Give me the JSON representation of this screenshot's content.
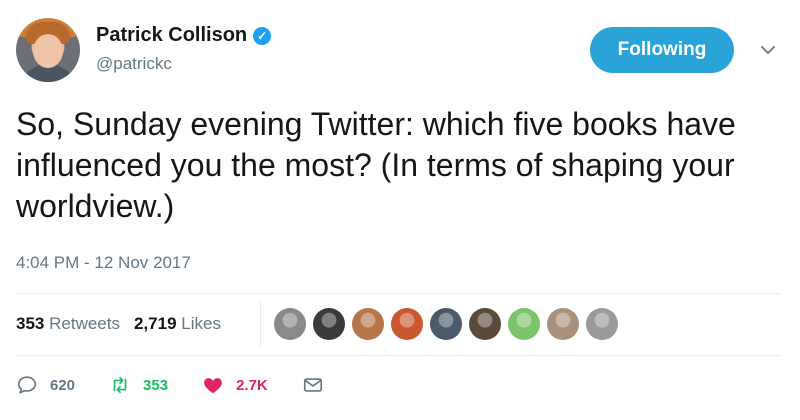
{
  "author": {
    "name": "Patrick Collison",
    "handle": "@patrickc",
    "verified_icon": "verified-badge-icon",
    "follow_label": "Following"
  },
  "tweet": {
    "text": "So, Sunday evening Twitter: which five books have influenced you the most? (In terms of shaping your worldview.)",
    "timestamp": "4:04 PM - 12 Nov 2017"
  },
  "stats": {
    "retweets_count": "353",
    "retweets_label": "Retweets",
    "likes_count": "2,719",
    "likes_label": "Likes"
  },
  "likers": [
    {
      "name": "liker-avatar-1",
      "color": "#8a8a8a"
    },
    {
      "name": "liker-avatar-2",
      "color": "#3a3a3a"
    },
    {
      "name": "liker-avatar-3",
      "color": "#b5764a"
    },
    {
      "name": "liker-avatar-4",
      "color": "#c9582e"
    },
    {
      "name": "liker-avatar-5",
      "color": "#4a5a6a"
    },
    {
      "name": "liker-avatar-6",
      "color": "#5a4a3a"
    },
    {
      "name": "liker-avatar-7",
      "color": "#7cc46a"
    },
    {
      "name": "liker-avatar-8",
      "color": "#a8907a"
    },
    {
      "name": "liker-avatar-9",
      "color": "#9a9a9a"
    }
  ],
  "actions": {
    "reply_count": "620",
    "retweet_count": "353",
    "like_count": "2.7K"
  },
  "colors": {
    "accent": "#2aa4d8",
    "retweet": "#17bf63",
    "like": "#e0245e",
    "muted": "#657786"
  }
}
